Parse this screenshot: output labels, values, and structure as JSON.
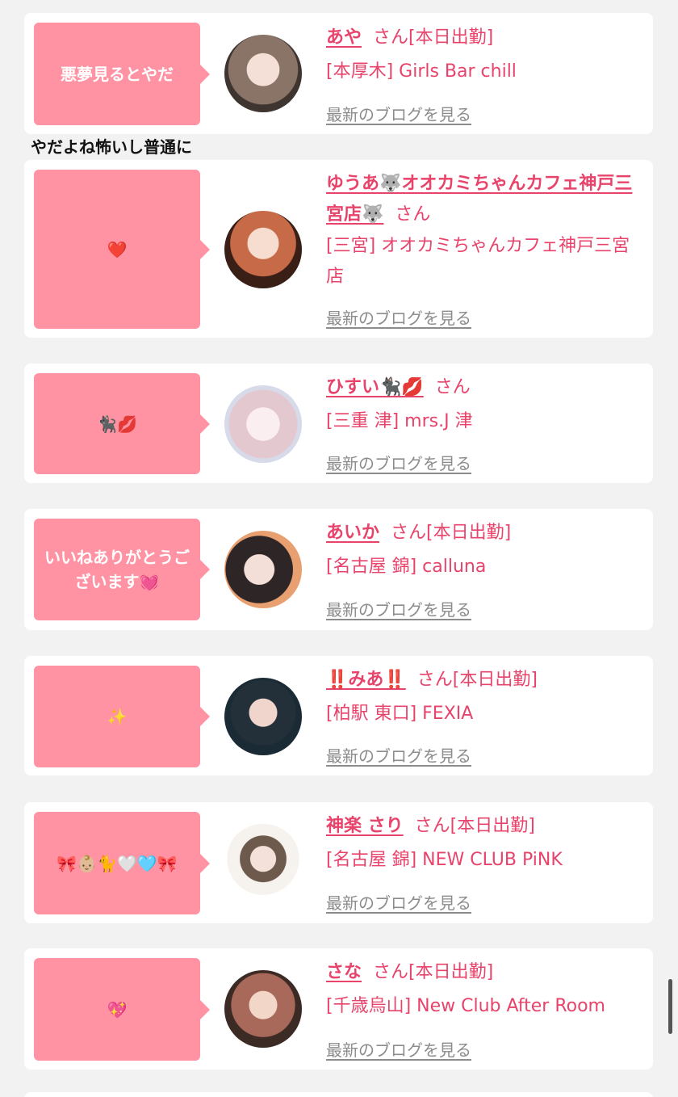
{
  "reply_text": "やだよね怖いし普通に",
  "blog_link_label": "最新のブログを見る",
  "items": [
    {
      "bubble": "悪夢見るとやだ",
      "name": "あや",
      "honor": "さん[本日出勤]",
      "shop": "[本厚木] Girls Bar chill"
    },
    {
      "bubble": "❤️",
      "name": "ゆうあ🐺オオカミちゃんカフェ神戸三宮店🐺",
      "honor": "さん",
      "shop": "[三宮] オオカミちゃんカフェ神戸三宮店"
    },
    {
      "bubble": "🐈‍⬛💋",
      "name": "ひすい🐈‍⬛💋",
      "honor": "さん",
      "shop": "[三重 津] mrs.J 津"
    },
    {
      "bubble": "いいねありがとうございます💓",
      "name": "あいか",
      "honor": "さん[本日出勤]",
      "shop": "[名古屋 錦] calluna"
    },
    {
      "bubble": "✨",
      "name": "‼️みあ‼️",
      "honor": "さん[本日出勤]",
      "shop": "[柏駅 東口] FEXIA"
    },
    {
      "bubble": "🎀👶🏼🐈🤍🩵🎀",
      "name": "神楽 さり",
      "honor": "さん[本日出勤]",
      "shop": "[名古屋 錦] NEW CLUB PiNK"
    },
    {
      "bubble": "💖",
      "name": "さな",
      "honor": "さん[本日出勤]",
      "shop": "[千歳烏山] New Club After Room"
    }
  ]
}
